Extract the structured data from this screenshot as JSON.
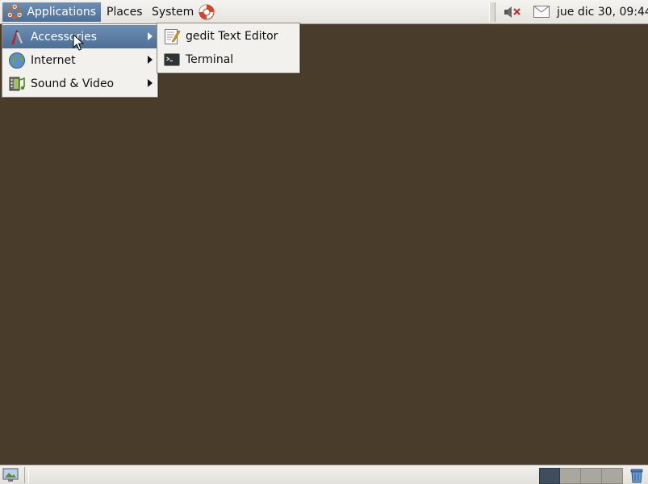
{
  "top_panel": {
    "menus": [
      {
        "label": "Applications",
        "icon": "ubuntu-logo-icon",
        "active": true
      },
      {
        "label": "Places"
      },
      {
        "label": "System"
      }
    ],
    "help_icon": "help-lifebuoy-icon",
    "tray_icons": [
      "volume-muted-icon",
      "mail-icon"
    ],
    "clock": "jue dic 30, 09:44"
  },
  "applications_menu": {
    "items": [
      {
        "label": "Accessories",
        "icon": "accessories-icon",
        "has_submenu": true,
        "selected": true
      },
      {
        "label": "Internet",
        "icon": "internet-globe-icon",
        "has_submenu": true
      },
      {
        "label": "Sound & Video",
        "icon": "sound-video-icon",
        "has_submenu": true
      }
    ]
  },
  "accessories_submenu": {
    "items": [
      {
        "label": "gedit Text Editor",
        "icon": "text-editor-icon"
      },
      {
        "label": "Terminal",
        "icon": "terminal-icon"
      }
    ]
  },
  "bottom_panel": {
    "show_desktop_icon": "show-desktop-icon",
    "workspaces": [
      {
        "active": true
      },
      {
        "active": false
      },
      {
        "active": false
      },
      {
        "active": false
      }
    ],
    "trash_icon": "trash-icon"
  },
  "colors": {
    "desktop": "#4a3c2a",
    "selection": "#5a7ca3",
    "panel": "#ece9e3",
    "menu": "#f2f1ee"
  }
}
